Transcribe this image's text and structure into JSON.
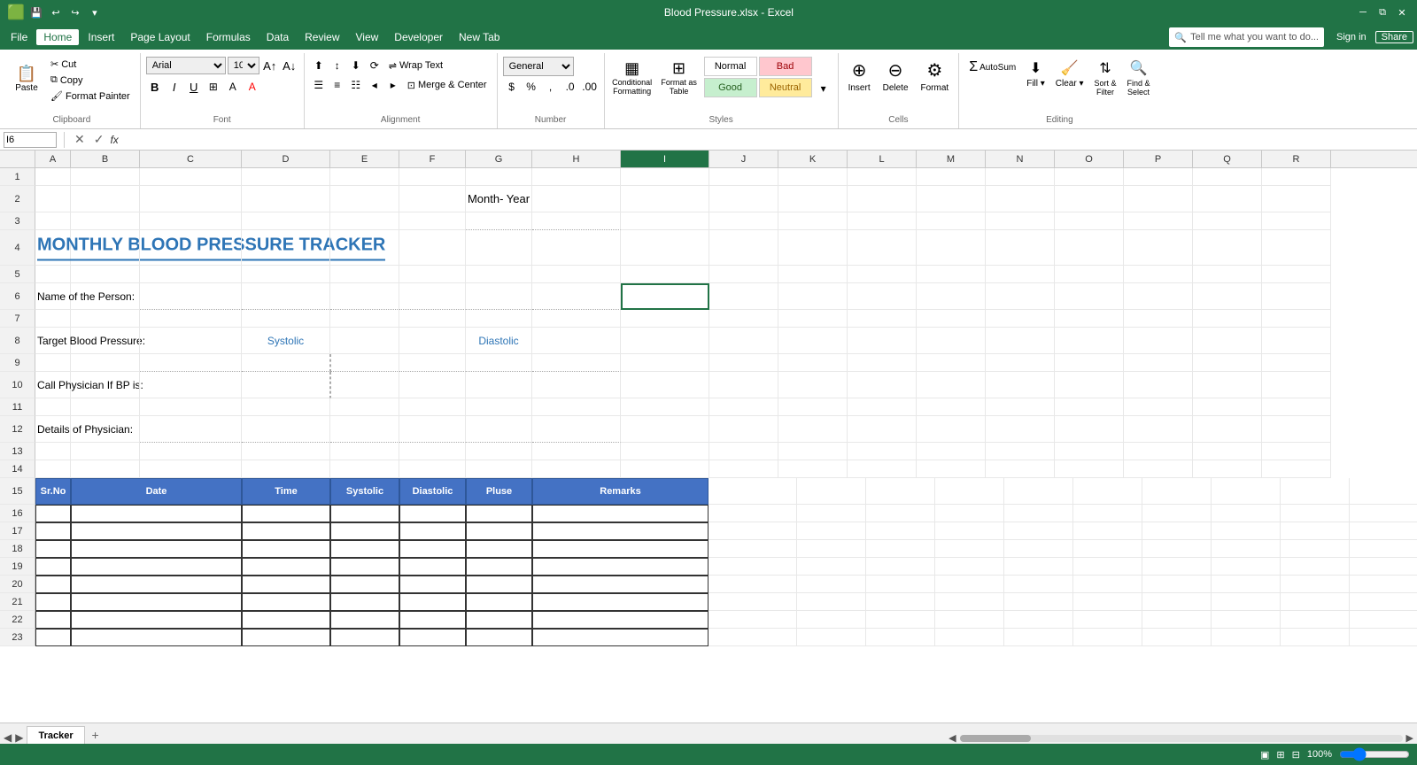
{
  "titlebar": {
    "title": "Blood Pressure.xlsx - Excel",
    "save_icon": "💾",
    "undo_icon": "↩",
    "redo_icon": "↪"
  },
  "menu": {
    "items": [
      "File",
      "Home",
      "Insert",
      "Page Layout",
      "Formulas",
      "Data",
      "Review",
      "View",
      "Developer",
      "New Tab"
    ],
    "active": "Home",
    "search_placeholder": "Tell me what you want to do...",
    "signin": "Sign in",
    "share": "Share"
  },
  "ribbon": {
    "clipboard": {
      "label": "Clipboard",
      "paste": "Paste",
      "cut": "Cut",
      "copy": "Copy",
      "format_painter": "Format Painter"
    },
    "font": {
      "label": "Font",
      "font_name": "Arial",
      "font_size": "10",
      "bold": "B",
      "italic": "I",
      "underline": "U",
      "border": "⊞",
      "fill": "A",
      "color": "A"
    },
    "alignment": {
      "label": "Alignment",
      "wrap_text": "Wrap Text",
      "merge_center": "Merge & Center"
    },
    "number": {
      "label": "Number",
      "format": "General"
    },
    "styles": {
      "label": "Styles",
      "normal": "Normal",
      "bad": "Bad",
      "good": "Good",
      "neutral": "Neutral",
      "conditional": "Conditional\nFormatting",
      "format_as_table": "Format as\nTable"
    },
    "cells": {
      "label": "Cells",
      "insert": "Insert",
      "delete": "Delete",
      "format": "Format"
    },
    "editing": {
      "label": "Editing",
      "autosum": "AutoSum",
      "fill": "Fill ▾",
      "clear": "Clear ▾",
      "sort_filter": "Sort &\nFilter",
      "find_select": "Find &\nSelect"
    }
  },
  "formula_bar": {
    "cell_ref": "I6"
  },
  "columns": [
    "A",
    "B",
    "C",
    "D",
    "E",
    "F",
    "G",
    "H",
    "I",
    "J",
    "K",
    "L",
    "M",
    "N",
    "O",
    "P",
    "Q",
    "R"
  ],
  "spreadsheet": {
    "title": "MONTHLY BLOOD PRESSURE TRACKER",
    "month_year": "Month- Year",
    "name_label": "Name of the Person:",
    "target_label": "Target Blood Pressure:",
    "systolic_label": "Systolic",
    "diastolic_label": "Diastolic",
    "call_label": "Call Physician If BP is:",
    "details_label": "Details of Physician:",
    "table_headers": [
      "Sr.No",
      "Date",
      "Time",
      "Systolic",
      "Diastolic",
      "Pluse",
      "Remarks"
    ],
    "rows": [
      "15",
      "16",
      "17",
      "18",
      "19",
      "20",
      "21",
      "22",
      "23"
    ]
  },
  "sheet_tabs": {
    "sheets": [
      "Tracker"
    ],
    "active": "Tracker",
    "add_label": "+"
  },
  "status_bar": {
    "left": "",
    "right": "🔍 100%"
  }
}
